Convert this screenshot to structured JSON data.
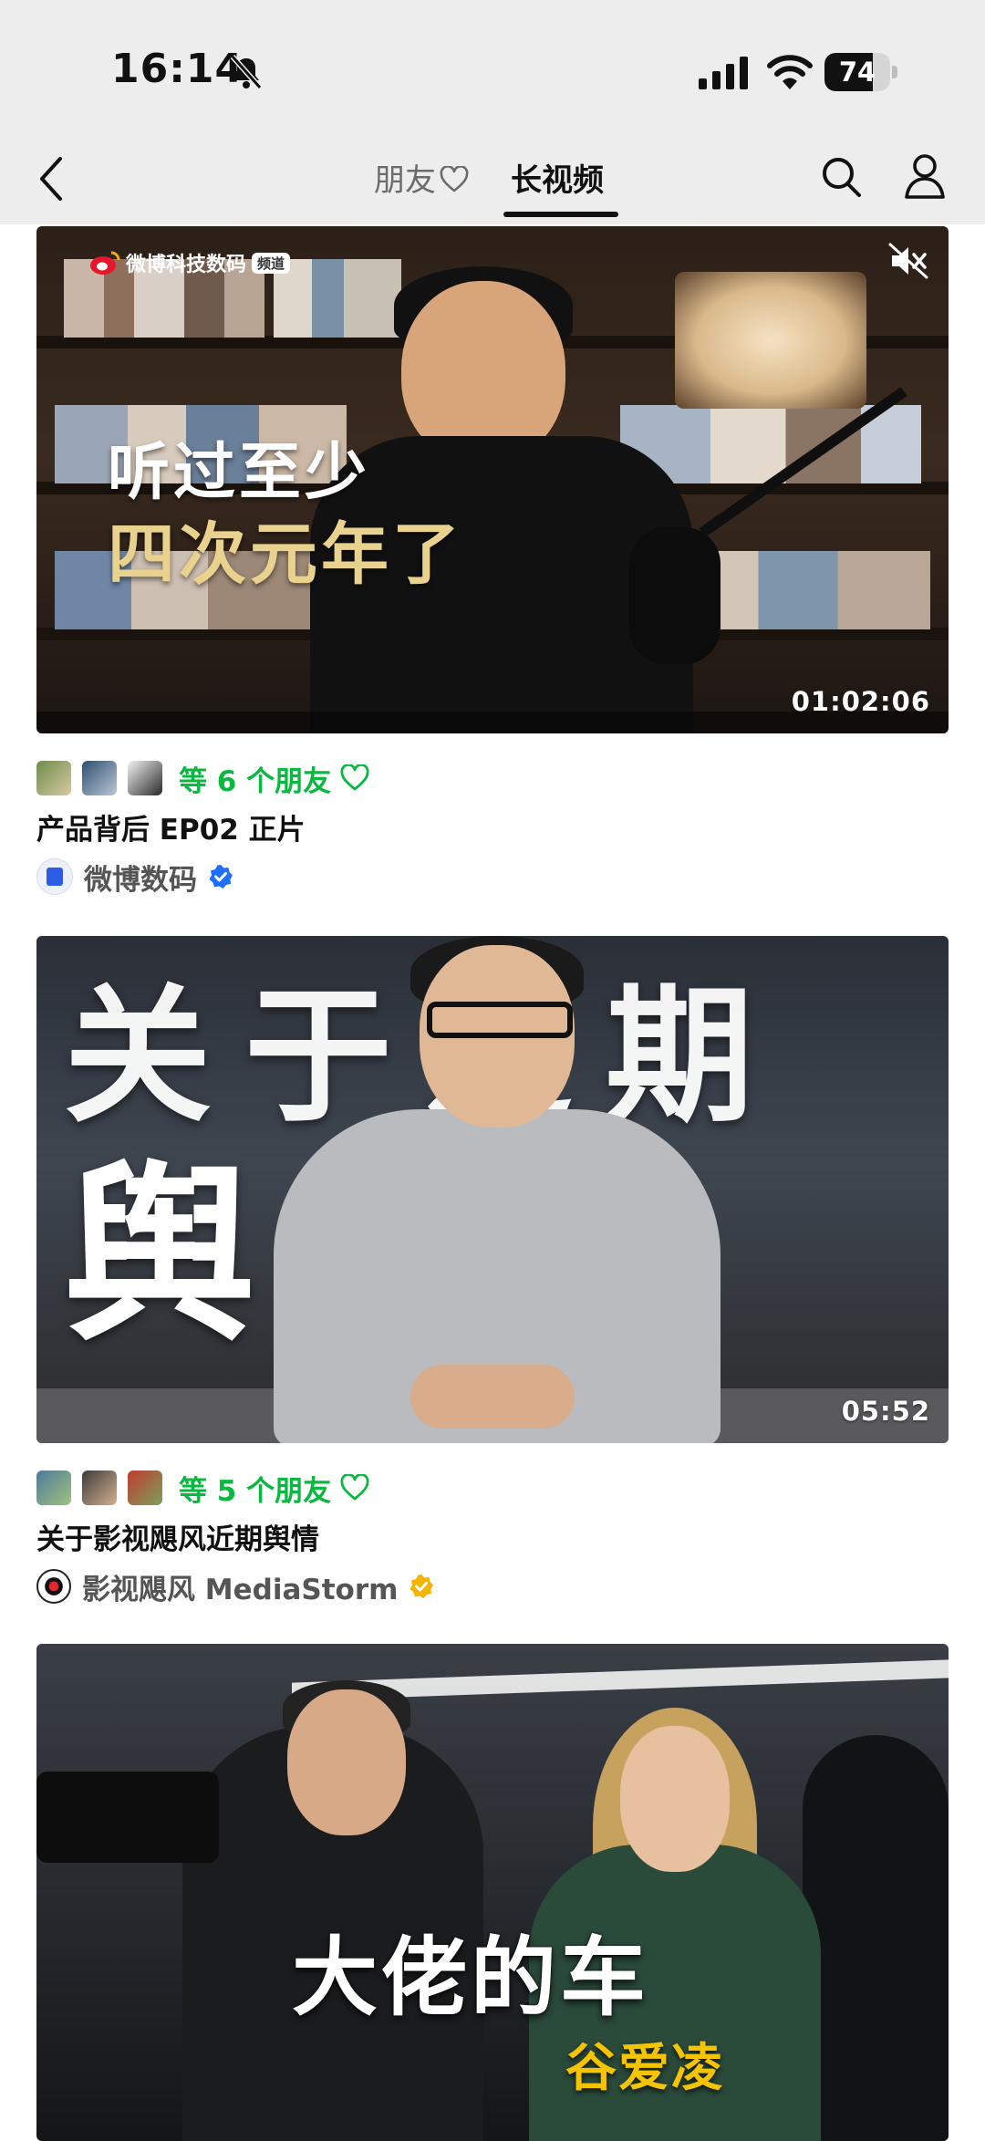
{
  "status_bar": {
    "time": "16:14",
    "battery": "74",
    "battery_level": 0.74
  },
  "nav": {
    "tab_friends": "朋友",
    "tab_long_video": "长视频"
  },
  "feed": [
    {
      "thumb_channel": "微博科技数码",
      "thumb_channel_tag": "频道",
      "thumb_caption_line1": "听过至少",
      "thumb_caption_line2": "四次元年了",
      "duration": "01:02:06",
      "friends_text": "等 6 个朋友",
      "title": "产品背后 EP02 正片",
      "author": "微博数码",
      "verified_color": "#1e6fff"
    },
    {
      "thumb_caption_top": "关于近期",
      "thumb_caption_bottom": "舆情",
      "duration": "05:52",
      "friends_text": "等 5 个朋友",
      "title": "关于影视飓风近期舆情",
      "author": "影视飓风 MediaStorm",
      "verified_color": "#f4b400"
    },
    {
      "thumb_caption_line1": "大佬的车",
      "thumb_caption_line2": "谷爱凌"
    }
  ],
  "colors": {
    "accent_green": "#09b83e",
    "topbar_bg": "#ededed"
  }
}
